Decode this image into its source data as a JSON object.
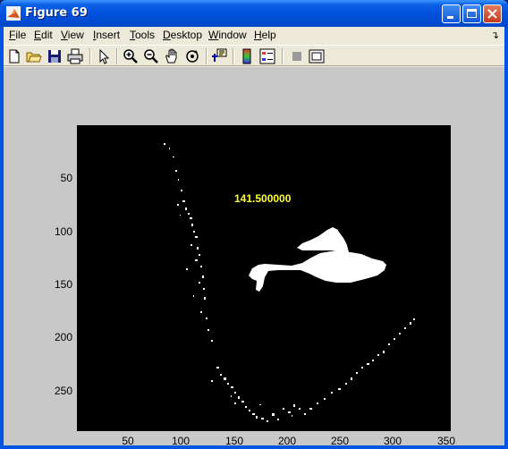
{
  "window": {
    "title": "Figure 69"
  },
  "menu": [
    {
      "pre": "",
      "ul": "F",
      "post": "ile"
    },
    {
      "pre": "",
      "ul": "E",
      "post": "dit"
    },
    {
      "pre": "",
      "ul": "V",
      "post": "iew"
    },
    {
      "pre": "",
      "ul": "I",
      "post": "nsert"
    },
    {
      "pre": "",
      "ul": "T",
      "post": "ools"
    },
    {
      "pre": "",
      "ul": "D",
      "post": "esktop"
    },
    {
      "pre": "",
      "ul": "W",
      "post": "indow"
    },
    {
      "pre": "",
      "ul": "H",
      "post": "elp"
    }
  ],
  "toolbar": {
    "icons": [
      "new-file-icon",
      "open-file-icon",
      "save-icon",
      "print-icon",
      "pointer-icon",
      "zoom-in-icon",
      "zoom-out-icon",
      "pan-icon",
      "rotate-icon",
      "data-cursor-icon",
      "colorbar-icon",
      "legend-icon",
      "hide-plot-tools-icon",
      "show-plot-tools-icon"
    ]
  },
  "plot": {
    "annotation": "141.500000",
    "y_ticks": [
      "50",
      "100",
      "150",
      "200",
      "250"
    ],
    "x_ticks": [
      "50",
      "100",
      "150",
      "200",
      "250",
      "300",
      "350"
    ],
    "colors": {
      "axes_bg": "#000000",
      "figure_bg": "#c8c8c8",
      "annotation": "#ffff33",
      "blob": "#ffffff"
    }
  }
}
